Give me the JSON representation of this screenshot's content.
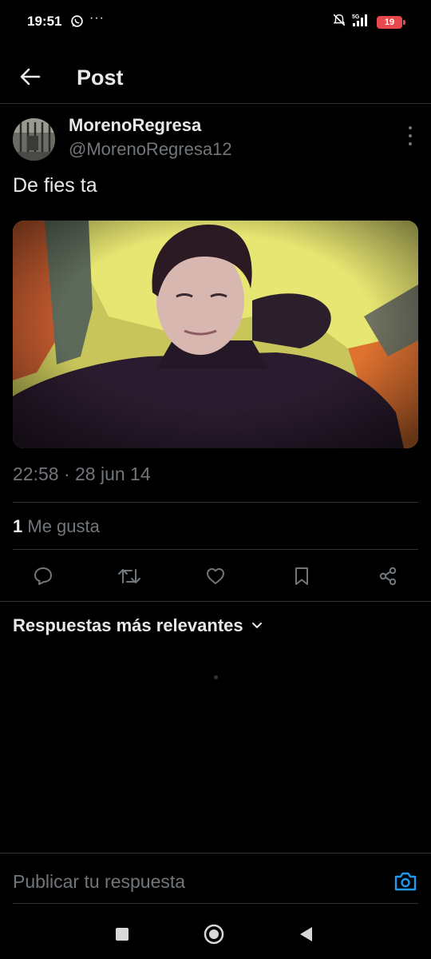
{
  "status_bar": {
    "time": "19:51",
    "more": "···",
    "network": "5G",
    "battery": "19"
  },
  "header": {
    "title": "Post"
  },
  "post": {
    "author_name": "MorenoRegresa",
    "author_handle": "@MorenoRegresa12",
    "text": "De fies ta",
    "timestamp": "22:58 · 28 jun 14",
    "likes_count": "1",
    "likes_label": "Me gusta"
  },
  "actions": [
    "reply-icon",
    "retweet-icon",
    "like-icon",
    "bookmark-icon",
    "share-icon"
  ],
  "replies": {
    "sort_label": "Respuestas más relevantes"
  },
  "reply_bar": {
    "placeholder": "Publicar tu respuesta"
  },
  "colors": {
    "accent": "#1d9bf0",
    "text": "#e7e9ea",
    "muted": "#71767b",
    "divider": "#2f3336"
  }
}
